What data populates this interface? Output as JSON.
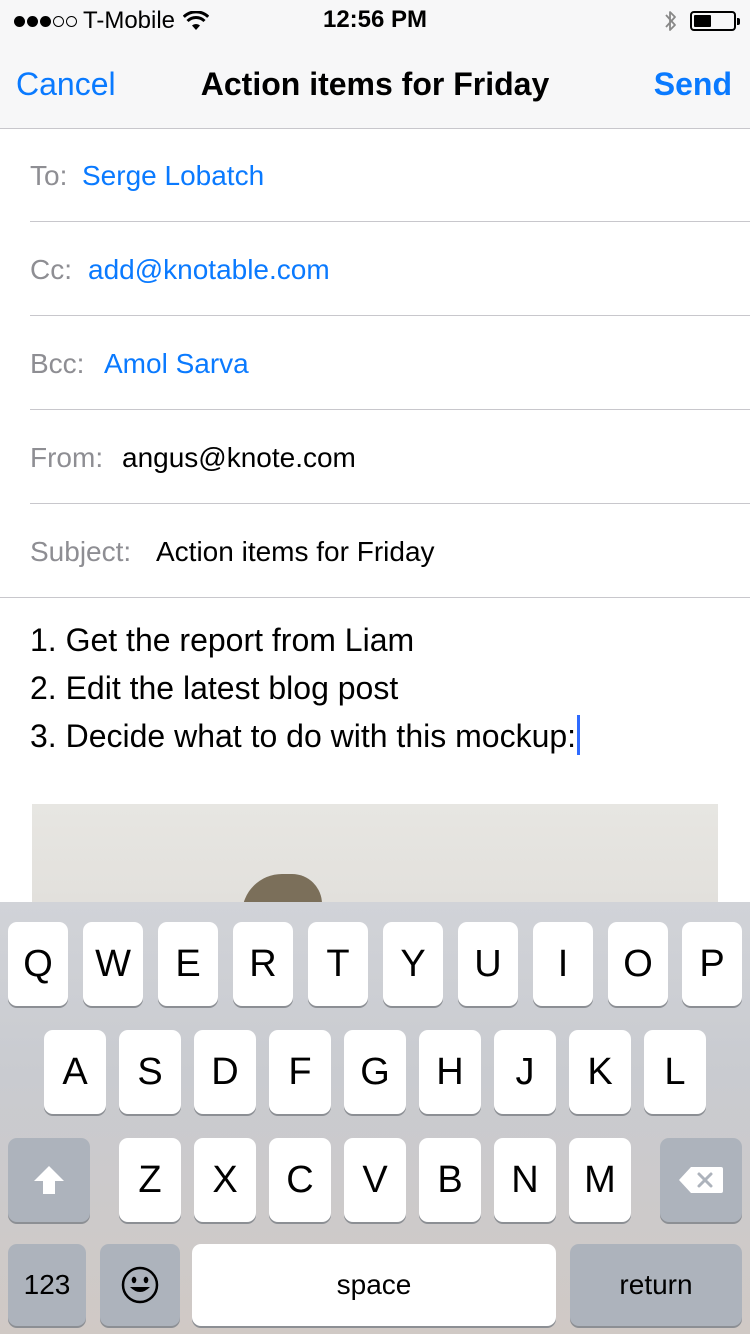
{
  "status_bar": {
    "carrier": "T-Mobile",
    "signal_bars": 5,
    "signal_filled": 3,
    "time": "12:56 PM",
    "battery_level": 0.45
  },
  "nav": {
    "cancel": "Cancel",
    "title": "Action items for Friday",
    "send": "Send"
  },
  "fields": {
    "to": {
      "label": "To:",
      "value": "Serge Lobatch"
    },
    "cc": {
      "label": "Cc:",
      "value": "add@knotable.com"
    },
    "bcc": {
      "label": "Bcc:",
      "value": "Amol Sarva"
    },
    "from": {
      "label": "From:",
      "value": "angus@knote.com"
    },
    "subject": {
      "label": "Subject:",
      "value": "Action items for Friday"
    }
  },
  "body": {
    "lines": [
      "1. Get the report from Liam",
      "2. Edit the latest blog post",
      "3. Decide what to do with this mockup:"
    ]
  },
  "keyboard": {
    "row1": [
      "Q",
      "W",
      "E",
      "R",
      "T",
      "Y",
      "U",
      "I",
      "O",
      "P"
    ],
    "row2": [
      "A",
      "S",
      "D",
      "F",
      "G",
      "H",
      "J",
      "K",
      "L"
    ],
    "row3": [
      "Z",
      "X",
      "C",
      "V",
      "B",
      "N",
      "M"
    ],
    "numbers": "123",
    "space": "space",
    "return": "return"
  },
  "colors": {
    "accent": "#0a7aff",
    "label_gray": "#8e8e93",
    "cursor": "#2f6bff"
  },
  "icons": {
    "wifi": "wifi-icon",
    "bluetooth": "bluetooth-icon",
    "battery": "battery-icon",
    "shift": "shift-icon",
    "delete": "delete-icon",
    "emoji": "emoji-icon"
  }
}
